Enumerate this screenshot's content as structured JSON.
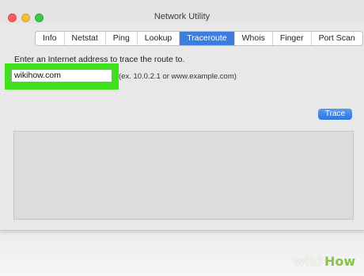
{
  "window": {
    "title": "Network Utility"
  },
  "tabs": [
    "Info",
    "Netstat",
    "Ping",
    "Lookup",
    "Traceroute",
    "Whois",
    "Finger",
    "Port Scan"
  ],
  "active_tab": "Traceroute",
  "traceroute": {
    "prompt": "Enter an Internet address to trace the route to.",
    "address_value": "wikihow.com",
    "hint": "(ex. 10.0.2.1 or www.example.com)",
    "trace_label": "Trace"
  },
  "watermark": {
    "wiki": "wiki",
    "how": "How"
  },
  "colors": {
    "accent": "#3d7ddd",
    "highlight": "#3ee11c"
  }
}
